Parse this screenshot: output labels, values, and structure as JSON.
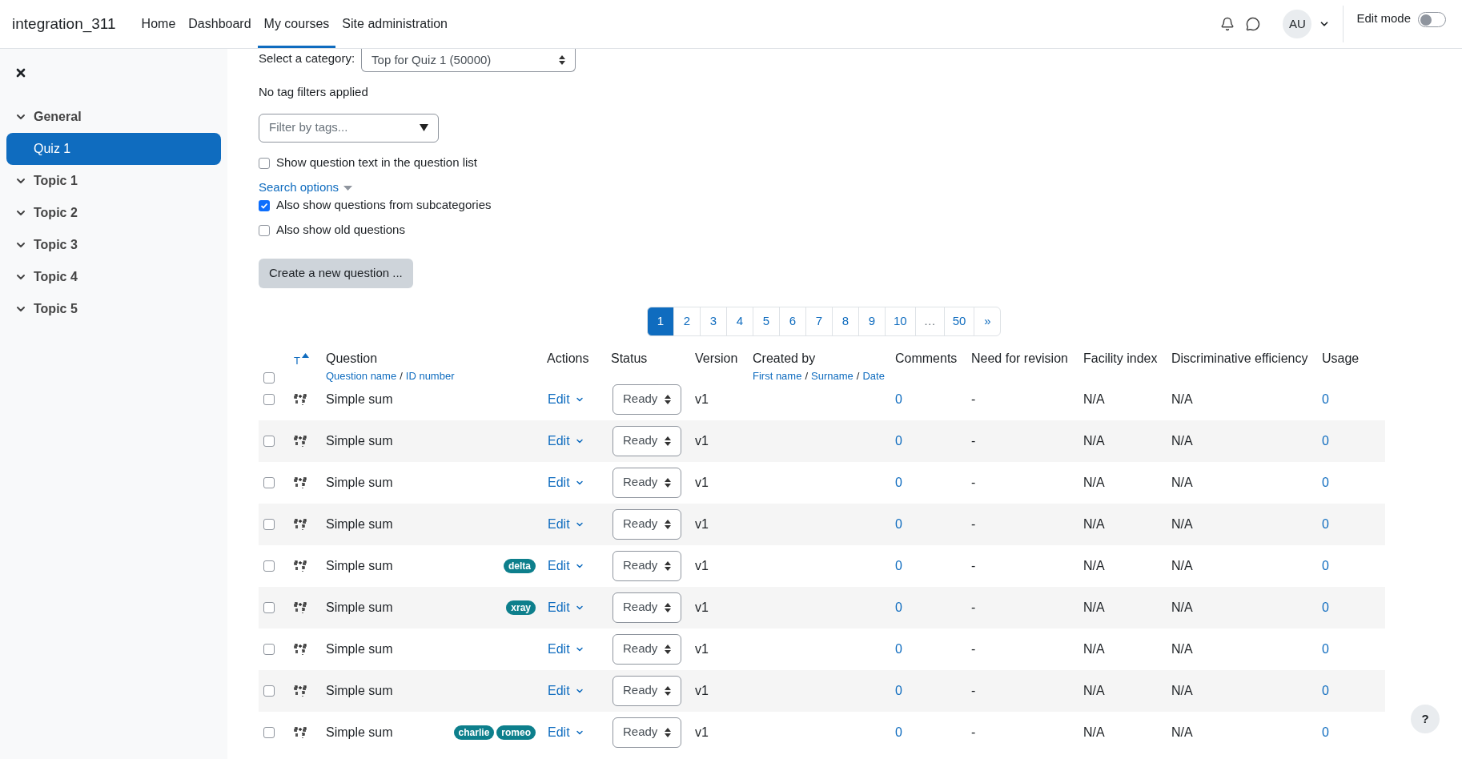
{
  "header": {
    "site_name": "integration_311",
    "nav": [
      {
        "label": "Home",
        "selected": false
      },
      {
        "label": "Dashboard",
        "selected": false
      },
      {
        "label": "My courses",
        "selected": true
      },
      {
        "label": "Site administration",
        "selected": false
      }
    ],
    "avatar": "AU",
    "edit_mode": {
      "label": "Edit mode",
      "on": false
    }
  },
  "sidebar": {
    "items": [
      {
        "label": "General",
        "kind": "section",
        "expanded": true,
        "selected": false
      },
      {
        "label": "Quiz 1",
        "kind": "activity",
        "selected": true
      },
      {
        "label": "Topic 1",
        "kind": "section",
        "expanded": true,
        "selected": false
      },
      {
        "label": "Topic 2",
        "kind": "section",
        "expanded": true,
        "selected": false
      },
      {
        "label": "Topic 3",
        "kind": "section",
        "expanded": true,
        "selected": false
      },
      {
        "label": "Topic 4",
        "kind": "section",
        "expanded": true,
        "selected": false
      },
      {
        "label": "Topic 5",
        "kind": "section",
        "expanded": true,
        "selected": false
      }
    ]
  },
  "filters": {
    "category_label": "Select a category:",
    "category_value": "Top for Quiz 1 (50000)",
    "tag_status": "No tag filters applied",
    "tag_placeholder": "Filter by tags...",
    "show_text": {
      "label": "Show question text in the question list",
      "checked": false
    },
    "search_options": "Search options",
    "options": [
      {
        "label": "Also show questions from subcategories",
        "checked": true
      },
      {
        "label": "Also show old questions",
        "checked": false
      }
    ],
    "create_button": "Create a new question ..."
  },
  "pagination": [
    {
      "label": "1",
      "selected": true,
      "disabled": false
    },
    {
      "label": "2",
      "selected": false,
      "disabled": false
    },
    {
      "label": "3",
      "selected": false,
      "disabled": false
    },
    {
      "label": "4",
      "selected": false,
      "disabled": false
    },
    {
      "label": "5",
      "selected": false,
      "disabled": false
    },
    {
      "label": "6",
      "selected": false,
      "disabled": false
    },
    {
      "label": "7",
      "selected": false,
      "disabled": false
    },
    {
      "label": "8",
      "selected": false,
      "disabled": false
    },
    {
      "label": "9",
      "selected": false,
      "disabled": false
    },
    {
      "label": "10",
      "selected": false,
      "disabled": false
    },
    {
      "label": "…",
      "selected": false,
      "disabled": true
    },
    {
      "label": "50",
      "selected": false,
      "disabled": false
    },
    {
      "label": "»",
      "selected": false,
      "disabled": false
    }
  ],
  "table": {
    "select_all": false,
    "sort_column": "T",
    "question_column": {
      "label": "Question",
      "links": [
        {
          "text": "Question name",
          "kind": "link"
        },
        {
          "text": "/",
          "kind": "sep"
        },
        {
          "text": "ID number",
          "kind": "link"
        }
      ]
    },
    "actions_column": "Actions",
    "status_column": "Status",
    "version_column": "Version",
    "created_column": {
      "label": "Created by",
      "links": [
        {
          "text": "First name",
          "kind": "link"
        },
        {
          "text": "/",
          "kind": "sep"
        },
        {
          "text": "Surname",
          "kind": "link"
        },
        {
          "text": "/",
          "kind": "sep"
        },
        {
          "text": "Date",
          "kind": "link"
        }
      ]
    },
    "other_columns": [
      "Comments",
      "Need for revision",
      "Facility index",
      "Discriminative efficiency",
      "Usage"
    ],
    "rows": [
      {
        "checked": false,
        "question": "Simple sum",
        "tags": [],
        "action": "Edit",
        "status": "Ready",
        "version": "v1",
        "comments": "0",
        "revision": "-",
        "facility": "N/A",
        "discrimination": "N/A",
        "usage": "0"
      },
      {
        "checked": false,
        "question": "Simple sum",
        "tags": [],
        "action": "Edit",
        "status": "Ready",
        "version": "v1",
        "comments": "0",
        "revision": "-",
        "facility": "N/A",
        "discrimination": "N/A",
        "usage": "0"
      },
      {
        "checked": false,
        "question": "Simple sum",
        "tags": [],
        "action": "Edit",
        "status": "Ready",
        "version": "v1",
        "comments": "0",
        "revision": "-",
        "facility": "N/A",
        "discrimination": "N/A",
        "usage": "0"
      },
      {
        "checked": false,
        "question": "Simple sum",
        "tags": [],
        "action": "Edit",
        "status": "Ready",
        "version": "v1",
        "comments": "0",
        "revision": "-",
        "facility": "N/A",
        "discrimination": "N/A",
        "usage": "0"
      },
      {
        "checked": false,
        "question": "Simple sum",
        "tags": [
          "delta"
        ],
        "action": "Edit",
        "status": "Ready",
        "version": "v1",
        "comments": "0",
        "revision": "-",
        "facility": "N/A",
        "discrimination": "N/A",
        "usage": "0"
      },
      {
        "checked": false,
        "question": "Simple sum",
        "tags": [
          "xray"
        ],
        "action": "Edit",
        "status": "Ready",
        "version": "v1",
        "comments": "0",
        "revision": "-",
        "facility": "N/A",
        "discrimination": "N/A",
        "usage": "0"
      },
      {
        "checked": false,
        "question": "Simple sum",
        "tags": [],
        "action": "Edit",
        "status": "Ready",
        "version": "v1",
        "comments": "0",
        "revision": "-",
        "facility": "N/A",
        "discrimination": "N/A",
        "usage": "0"
      },
      {
        "checked": false,
        "question": "Simple sum",
        "tags": [],
        "action": "Edit",
        "status": "Ready",
        "version": "v1",
        "comments": "0",
        "revision": "-",
        "facility": "N/A",
        "discrimination": "N/A",
        "usage": "0"
      },
      {
        "checked": false,
        "question": "Simple sum",
        "tags": [
          "charlie",
          "romeo"
        ],
        "action": "Edit",
        "status": "Ready",
        "version": "v1",
        "comments": "0",
        "revision": "-",
        "facility": "N/A",
        "discrimination": "N/A",
        "usage": "0"
      }
    ]
  },
  "help_button": "?"
}
